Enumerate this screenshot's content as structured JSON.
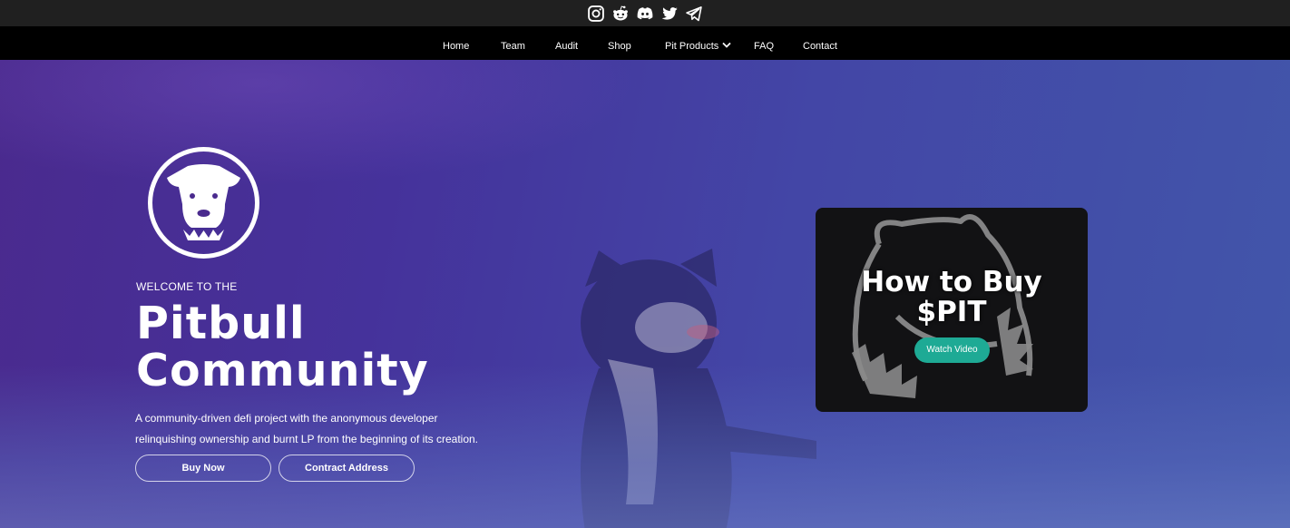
{
  "social": {
    "icons": [
      "instagram-icon",
      "reddit-icon",
      "discord-icon",
      "twitter-icon",
      "telegram-icon"
    ]
  },
  "nav": {
    "items": [
      "Home",
      "Team",
      "Audit",
      "Shop",
      "Pit Products",
      "FAQ",
      "Contact"
    ],
    "dropdown_icon": "chevron-down-icon"
  },
  "hero": {
    "welcome": "WELCOME TO THE",
    "title_line1": "Pitbull",
    "title_line2": "Community",
    "description_line1": "A community-driven defi project with the anonymous developer",
    "description_line2": "relinquishing ownership and burnt LP from the beginning of its creation.",
    "buy_button": "Buy Now",
    "contract_button": "Contract Address"
  },
  "video": {
    "title_line1": "How to Buy",
    "title_line2": "$PIT",
    "button": "Watch Video"
  },
  "colors": {
    "topbar": "#202020",
    "nav": "#000000",
    "hero_start": "#4a2a8e",
    "hero_end": "#4256aa",
    "accent": "#1eaa95"
  }
}
